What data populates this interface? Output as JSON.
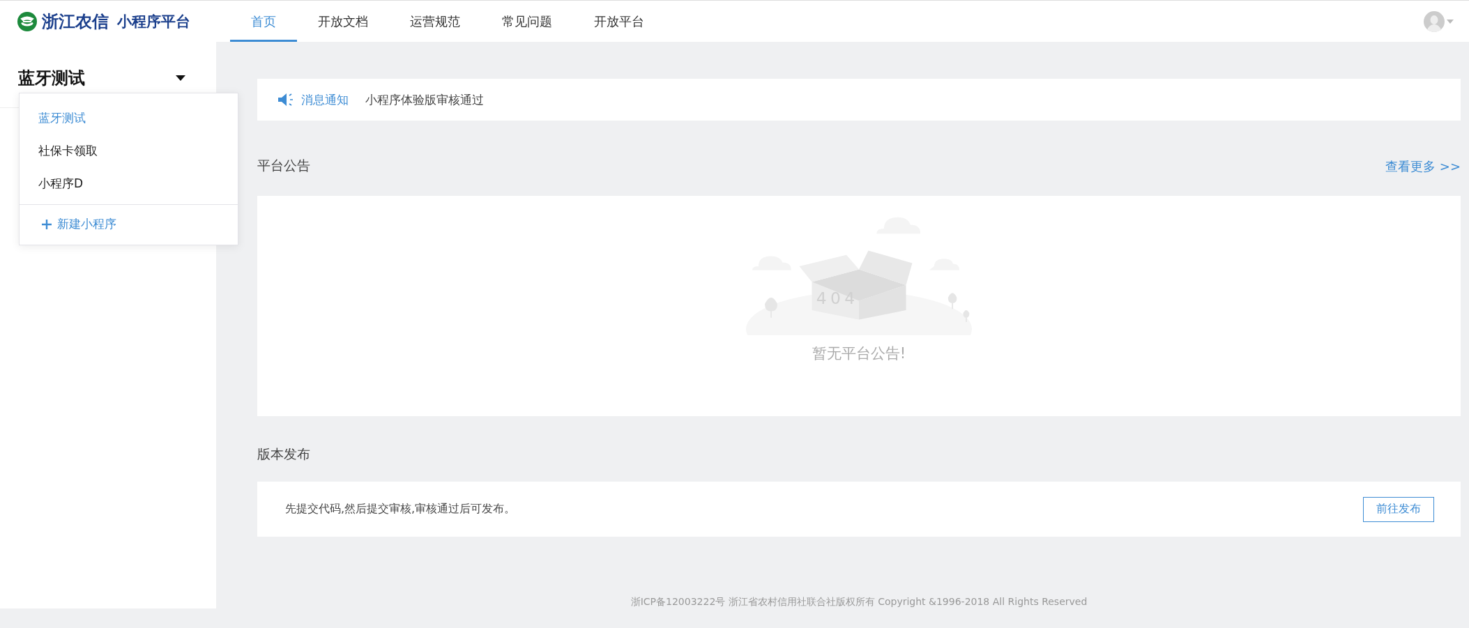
{
  "header": {
    "logo_text": "浙江农信",
    "logo_subtitle": "小程序平台",
    "nav_tabs": [
      {
        "label": "首页",
        "selected": true
      },
      {
        "label": "开放文档",
        "selected": false
      },
      {
        "label": "运营规范",
        "selected": false
      },
      {
        "label": "常见问题",
        "selected": false
      },
      {
        "label": "开放平台",
        "selected": false
      }
    ]
  },
  "sidebar": {
    "app_switcher": {
      "current": "蓝牙测试",
      "expanded": true,
      "items": [
        {
          "label": "蓝牙测试",
          "selected": true
        },
        {
          "label": "社保卡领取",
          "selected": false
        },
        {
          "label": "小程序D",
          "selected": false
        }
      ],
      "new_action": "新建小程序"
    }
  },
  "notification": {
    "label": "消息通知",
    "message": "小程序体验版审核通过"
  },
  "announcements": {
    "title": "平台公告",
    "more_link": "查看更多 >>",
    "illustration_label": "404",
    "empty_text": "暂无平台公告!"
  },
  "release": {
    "title": "版本发布",
    "description": "先提交代码,然后提交审核,审核通过后可发布。",
    "button": "前往发布"
  },
  "footer": "浙ICP备12003222号 浙江省农村信用社联合社版权所有 Copyright &1996-2018 All Rights Reserved"
}
